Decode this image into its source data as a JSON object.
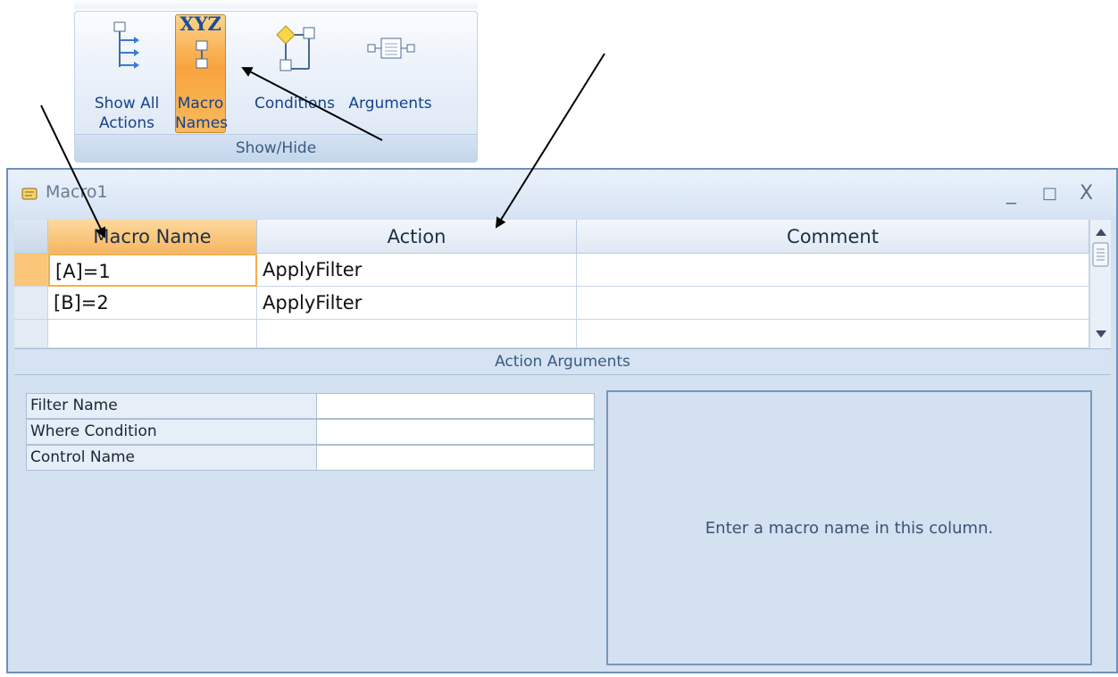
{
  "ribbon": {
    "group_label": "Show/Hide",
    "buttons": [
      {
        "line1": "Show All",
        "line2": "Actions",
        "icon": "show-all-actions-icon"
      },
      {
        "line1": "Macro",
        "line2": "Names",
        "icon": "macro-names-icon",
        "icon_text": "XYZ",
        "active": true
      },
      {
        "line1": "Conditions",
        "line2": "",
        "icon": "conditions-icon"
      },
      {
        "line1": "Arguments",
        "line2": "",
        "icon": "arguments-icon"
      }
    ]
  },
  "window": {
    "title": "Macro1",
    "controls": {
      "minimize": "_",
      "maximize": "□",
      "close": "X"
    }
  },
  "grid": {
    "columns": [
      "Macro Name",
      "Action",
      "Comment"
    ],
    "rows": [
      {
        "macro_name": "[A]=1",
        "action": "ApplyFilter",
        "comment": ""
      },
      {
        "macro_name": "[B]=2",
        "action": "ApplyFilter",
        "comment": ""
      },
      {
        "macro_name": "",
        "action": "",
        "comment": ""
      }
    ]
  },
  "action_arguments": {
    "title": "Action Arguments",
    "fields": [
      {
        "label": "Filter Name",
        "value": ""
      },
      {
        "label": "Where Condition",
        "value": ""
      },
      {
        "label": "Control Name",
        "value": ""
      }
    ],
    "help_text": "Enter a macro name in this column."
  },
  "colors": {
    "accent_active": "#f8a43e",
    "ribbon_text": "#15428b",
    "window_border": "#6f8fb8"
  }
}
